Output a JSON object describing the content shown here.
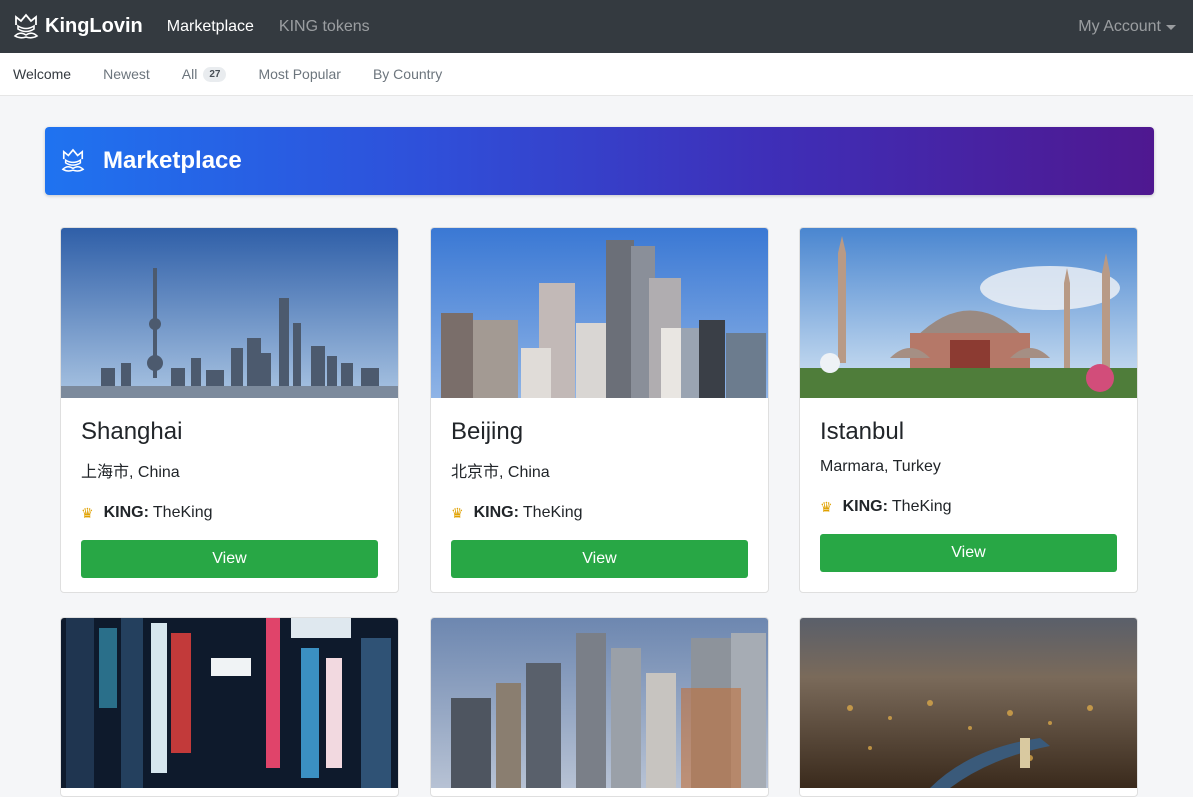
{
  "navbar": {
    "brand": "KingLovin",
    "links": [
      "Marketplace",
      "KING tokens"
    ],
    "account": "My Account"
  },
  "subnav": {
    "items": [
      "Welcome",
      "Newest",
      "All",
      "Most Popular",
      "By Country"
    ],
    "all_count": "27"
  },
  "banner": {
    "title": "Marketplace"
  },
  "cards": [
    {
      "city": "Shanghai",
      "region": "上海市, China",
      "king_label": "KING:",
      "king_name": "TheKing",
      "button": "View",
      "image_icon": "shanghai-skyline-photo"
    },
    {
      "city": "Beijing",
      "region": "北京市, China",
      "king_label": "KING:",
      "king_name": "TheKing",
      "button": "View",
      "image_icon": "beijing-skyline-photo"
    },
    {
      "city": "Istanbul",
      "region": "Marmara, Turkey",
      "king_label": "KING:",
      "king_name": "TheKing",
      "button": "View",
      "image_icon": "hagia-sophia-photo"
    }
  ],
  "colors": {
    "navbar": "#343a40",
    "button": "#28a745",
    "banner_start": "#1f73f0",
    "banner_end": "#4f1890"
  }
}
